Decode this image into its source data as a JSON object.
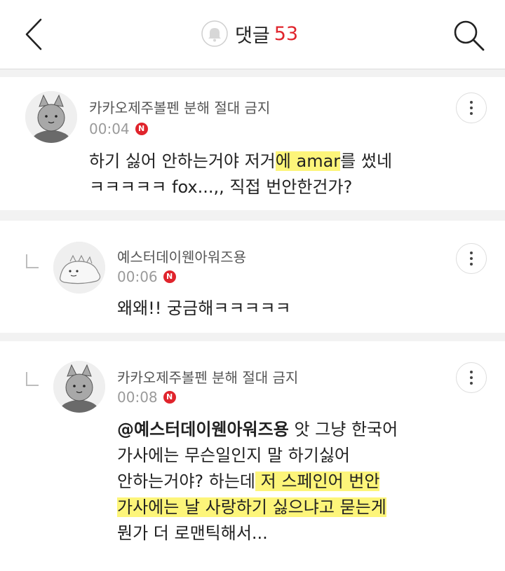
{
  "header": {
    "title": "댓글",
    "count": "53"
  },
  "comments": [
    {
      "author": "카카오제주볼펜 분해 절대 금지",
      "time": "00:04",
      "badge": "N",
      "line1_pre": "하기 싫어 안하는거야 저거",
      "line1_hl": "에 amar",
      "line1_post": "를 썼네",
      "line2": "ㅋㅋㅋㅋㅋ fox...,, 직접 번안한건가?"
    },
    {
      "author": "예스터데이웬아워즈용",
      "time": "00:06",
      "badge": "N",
      "line1": "왜왜!! 궁금해ㅋㅋㅋㅋㅋ"
    },
    {
      "author": "카카오제주볼펜 분해 절대 금지",
      "time": "00:08",
      "badge": "N",
      "mention": "@예스터데이웬아워즈용",
      "line1_rest": " 앗 그냥 한국어",
      "line2": "가사에는 무슨일인지 말 하기싫어",
      "line3_pre": "안하는거야? 하는데",
      "line3_hl": " 저 스페인어 번안",
      "line4_hl": "가사에는 날 사랑하기 싫으냐고 묻는게",
      "line5": "뭔가 더 로맨틱해서..."
    }
  ],
  "icons": {
    "back": "chevron-left-icon",
    "bell": "bell-icon",
    "search": "search-icon",
    "more": "more-vertical-icon"
  },
  "colors": {
    "accent": "#e0242c",
    "highlight": "#fdf57a"
  }
}
